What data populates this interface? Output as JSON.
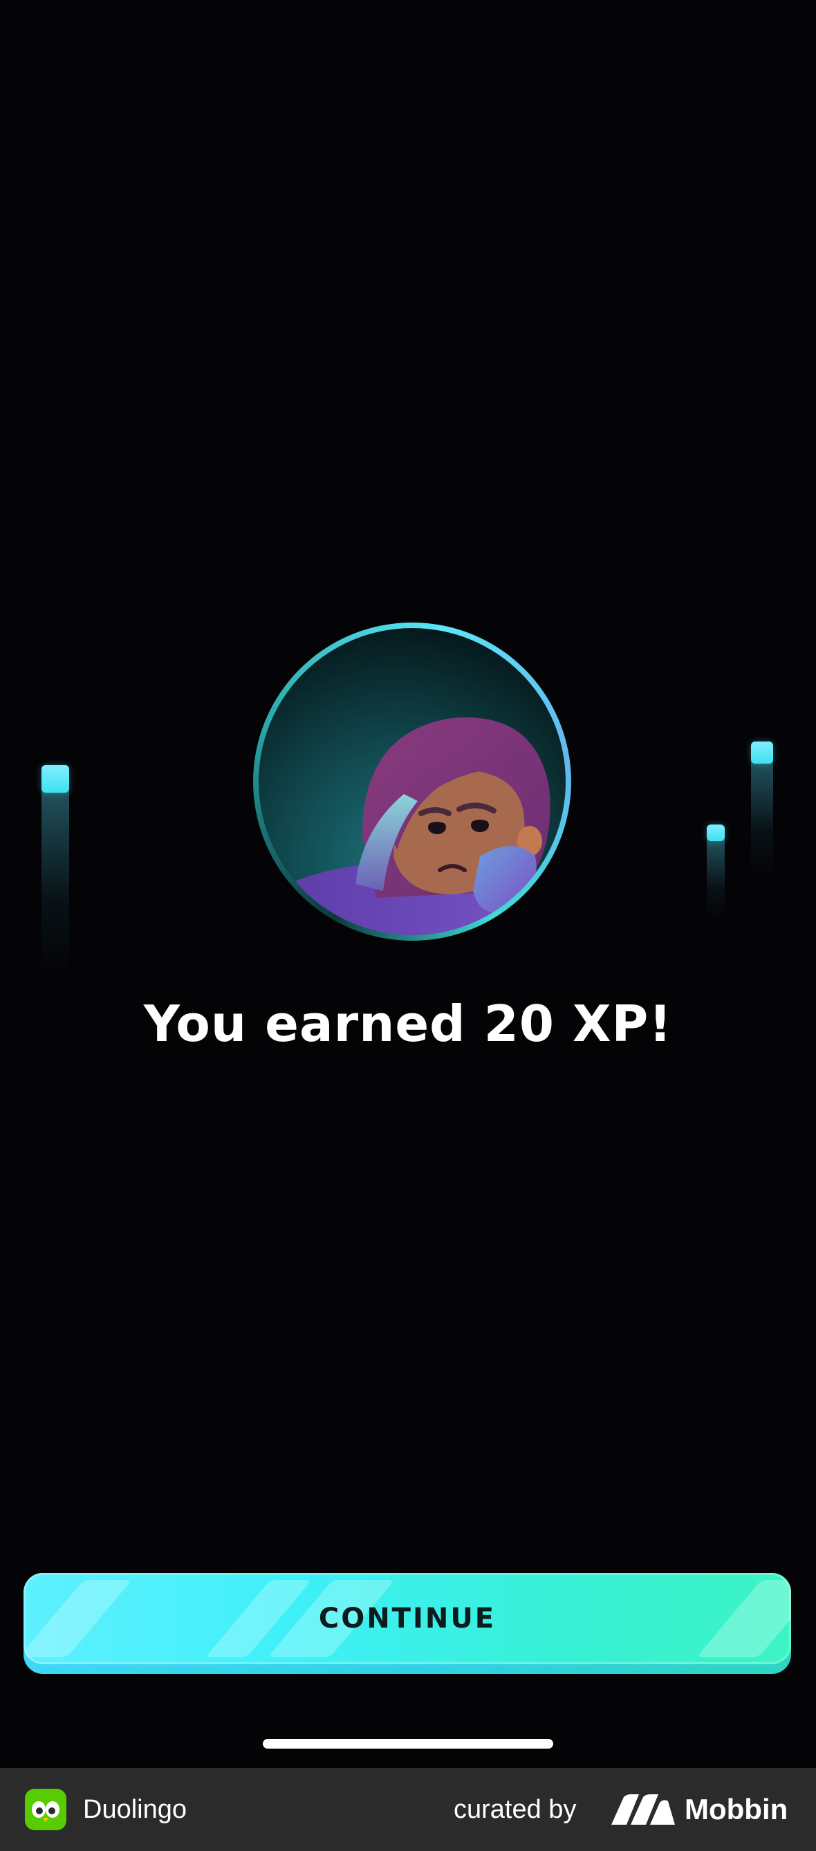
{
  "result": {
    "headline": "You earned 20 XP!"
  },
  "actions": {
    "continue_label": "CONTINUE"
  },
  "illustration": {
    "icon": "sad-character-avatar",
    "accent_color": "#4fe6f5"
  },
  "sparkles": {
    "icon": "sparkle-bar",
    "color": "#4fe6f5"
  },
  "footer": {
    "app_name": "Duolingo",
    "app_icon": "duolingo-owl-icon",
    "curated_by": "curated by",
    "brand_logo": "mobbin-logo-icon",
    "brand_name": "Mobbin"
  },
  "colors": {
    "background": "#040305",
    "button_gradient_start": "#5ef0ff",
    "button_gradient_end": "#3cf4c4",
    "footer_bg": "#2b2b2b"
  }
}
